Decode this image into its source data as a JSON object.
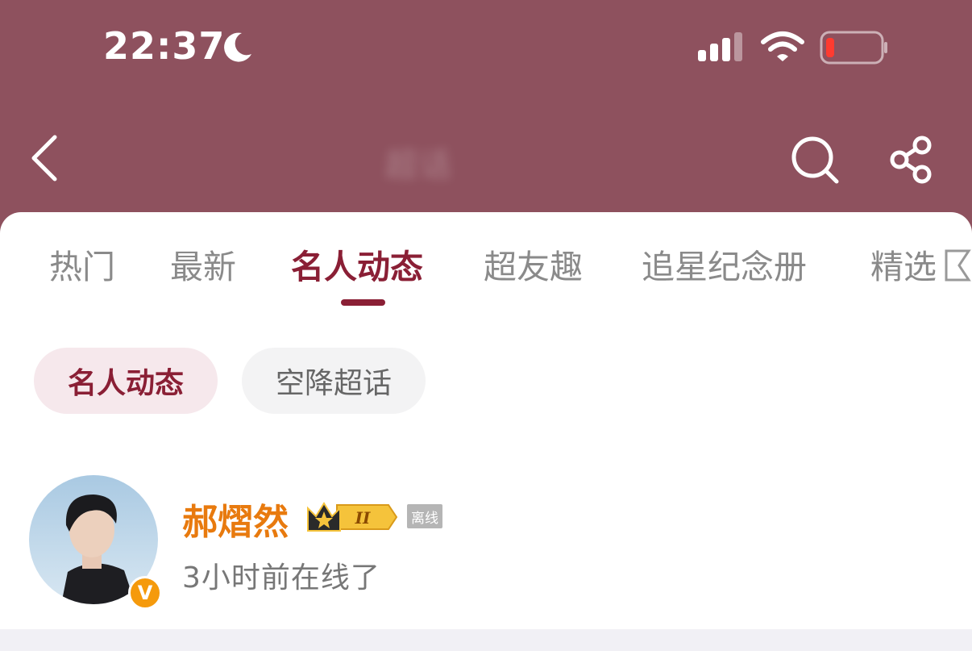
{
  "status_bar": {
    "time": "22:37",
    "icons": [
      "moon-icon",
      "cellular-signal-icon",
      "wifi-icon",
      "battery-low-icon"
    ]
  },
  "header": {
    "title": "超话",
    "icons": [
      "back-icon",
      "search-icon",
      "share-icon"
    ]
  },
  "tabs": [
    {
      "label": "热门",
      "active": false
    },
    {
      "label": "最新",
      "active": false
    },
    {
      "label": "名人动态",
      "active": true
    },
    {
      "label": "超友趣",
      "active": false
    },
    {
      "label": "追星纪念册",
      "active": false
    },
    {
      "label": "精选",
      "active": false
    }
  ],
  "sub_tabs": [
    {
      "label": "名人动态",
      "active": true
    },
    {
      "label": "空降超话",
      "active": false
    }
  ],
  "celebrity": {
    "name": "郝熠然",
    "level_badge": "II",
    "status_badge": "离线",
    "verified_label": "V",
    "last_online": "3小时前在线了"
  },
  "colors": {
    "header_bg": "#8e515e",
    "accent": "#8a1f35",
    "name_color": "#e87a0e",
    "verified_badge": "#f59a0c"
  }
}
